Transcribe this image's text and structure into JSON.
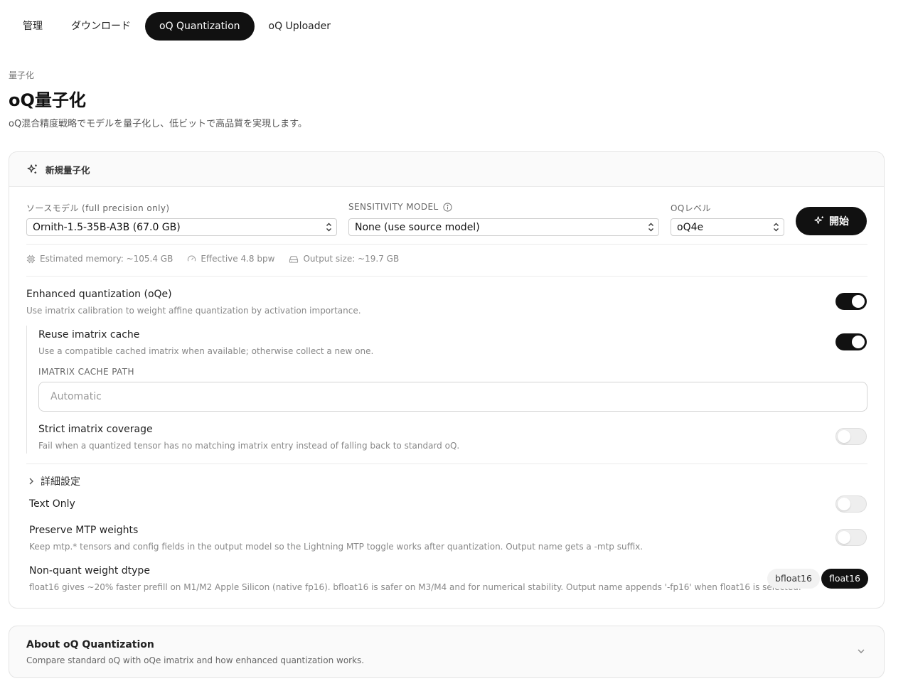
{
  "tabs": [
    {
      "label": "管理"
    },
    {
      "label": "ダウンロード"
    },
    {
      "label": "oQ Quantization",
      "active": true
    },
    {
      "label": "oQ Uploader"
    }
  ],
  "header": {
    "eyebrow": "量子化",
    "title": "oQ量子化",
    "description": "oQ混合精度戦略でモデルを量子化し、低ビットで高品質を実現します。"
  },
  "card": {
    "title": "新規量子化",
    "source_model": {
      "label": "ソースモデル (full precision only)",
      "value": "Ornith-1.5-35B-A3B (67.0 GB)"
    },
    "sensitivity_model": {
      "label": "SENSITIVITY MODEL",
      "value": "None (use source model)"
    },
    "oq_level": {
      "label": "OQレベル",
      "value": "oQ4e"
    },
    "start_label": "開始",
    "stats": {
      "memory": "Estimated memory: ~105.4 GB",
      "bpw": "Effective 4.8 bpw",
      "output": "Output size: ~19.7 GB"
    },
    "enhanced": {
      "title": "Enhanced quantization (oQe)",
      "desc": "Use imatrix calibration to weight affine quantization by activation importance.",
      "on": true
    },
    "reuse_cache": {
      "title": "Reuse imatrix cache",
      "desc": "Use a compatible cached imatrix when available; otherwise collect a new one.",
      "on": true
    },
    "cache_path": {
      "label": "IMATRIX CACHE PATH",
      "placeholder": "Automatic",
      "value": ""
    },
    "strict": {
      "title": "Strict imatrix coverage",
      "desc": "Fail when a quantized tensor has no matching imatrix entry instead of falling back to standard oQ.",
      "on": false
    },
    "advanced_label": "詳細設定",
    "text_only": {
      "title": "Text Only",
      "on": false
    },
    "preserve_mtp": {
      "title": "Preserve MTP weights",
      "desc": "Keep mtp.* tensors and config fields in the output model so the Lightning MTP toggle works after quantization. Output name gets a -mtp suffix.",
      "on": false
    },
    "dtype": {
      "title": "Non-quant weight dtype",
      "desc": "float16 gives ~20% faster prefill on M1/M2 Apple Silicon (native fp16). bfloat16 is safer on M3/M4 and for numerical stability. Output name appends '-fp16' when float16 is selected.",
      "options": [
        "bfloat16",
        "float16"
      ],
      "selected": "float16"
    }
  },
  "about": {
    "title": "About oQ Quantization",
    "desc": "Compare standard oQ with oQe imatrix and how enhanced quantization works."
  },
  "colors": {
    "accent": "#111111",
    "muted": "#888888",
    "border": "#e4e4e4"
  }
}
